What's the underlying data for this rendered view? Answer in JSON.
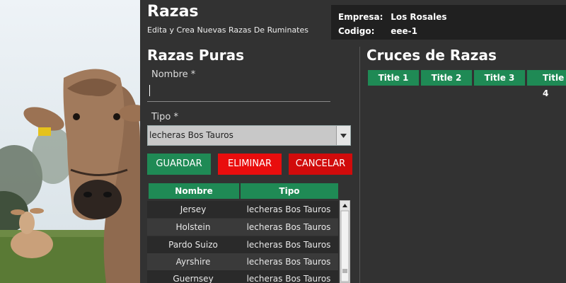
{
  "app": {
    "title": "Razas",
    "subtitle": "Edita y Crea Nuevas Razas De Ruminates"
  },
  "info": {
    "empresa_label": "Empresa:",
    "empresa_value": "Los Rosales",
    "codigo_label": "Codigo:",
    "codigo_value": "eee-1"
  },
  "razas_puras": {
    "heading": "Razas Puras",
    "nombre_label": "Nombre *",
    "nombre_value": "",
    "tipo_label": "Tipo *",
    "tipo_value": "lecheras Bos Tauros",
    "buttons": {
      "guardar": "GUARDAR",
      "eliminar": "ELIMINAR",
      "cancelar": "CANCELAR"
    },
    "table": {
      "headers": [
        "Nombre",
        "Tipo"
      ],
      "rows": [
        [
          "Jersey",
          "lecheras Bos Tauros"
        ],
        [
          "Holstein",
          "lecheras Bos Tauros"
        ],
        [
          "Pardo Suizo",
          "lecheras Bos Tauros"
        ],
        [
          "Ayrshire",
          "lecheras Bos Tauros"
        ],
        [
          "Guernsey",
          "lecheras Bos Tauros"
        ]
      ]
    }
  },
  "cruces": {
    "heading": "Cruces de Razas",
    "headers": [
      "Title 1",
      "Title 2",
      "Title 3",
      "Title 4"
    ]
  },
  "colors": {
    "accent": "#1f8a55",
    "danger": "#e90d0d",
    "panel": "#323232"
  }
}
